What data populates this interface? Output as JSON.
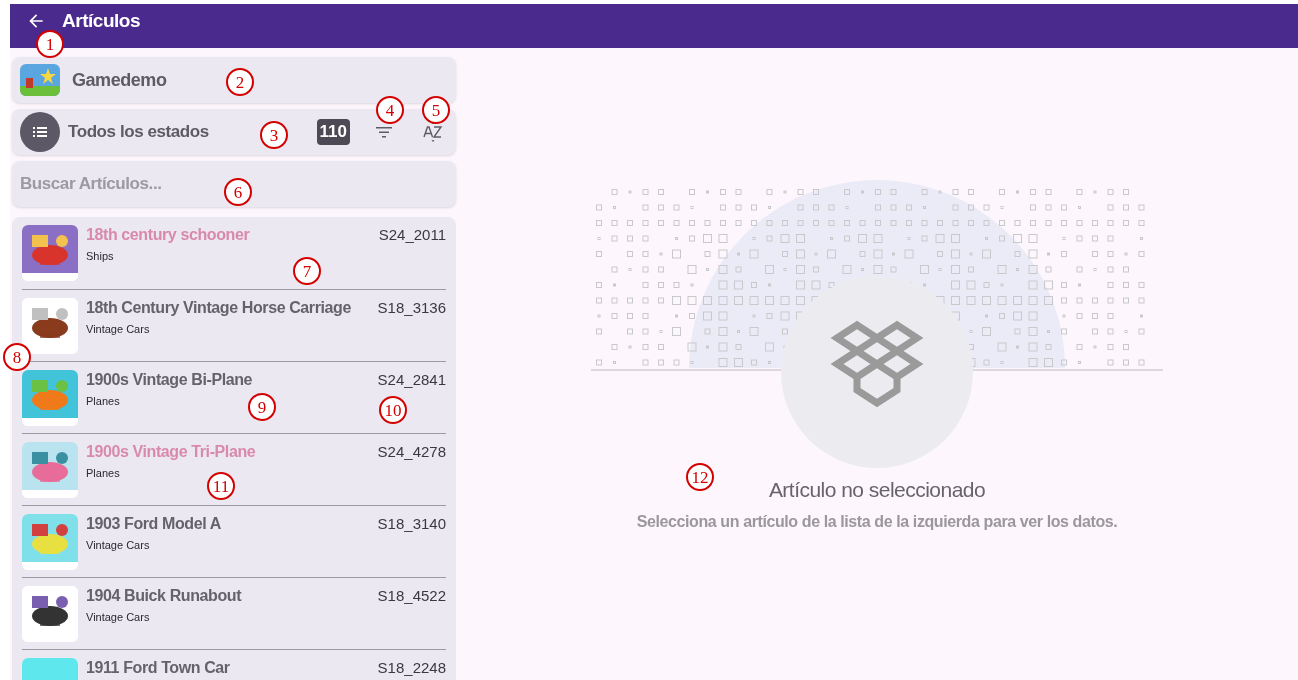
{
  "app_bar": {
    "title": "Artículos"
  },
  "company": {
    "name": "Gamedemo"
  },
  "status_filter": {
    "label": "Todos los estados",
    "count": "110"
  },
  "search": {
    "placeholder": "Buscar Artículos..."
  },
  "articles": [
    {
      "name": "18th century schooner",
      "category": "Ships",
      "code": "S24_2011",
      "inactive": true
    },
    {
      "name": "18th Century Vintage Horse Carriage",
      "category": "Vintage Cars",
      "code": "S18_3136",
      "inactive": false
    },
    {
      "name": "1900s Vintage Bi-Plane",
      "category": "Planes",
      "code": "S24_2841",
      "inactive": false
    },
    {
      "name": "1900s Vintage Tri-Plane",
      "category": "Planes",
      "code": "S24_4278",
      "inactive": true
    },
    {
      "name": "1903 Ford Model A",
      "category": "Vintage Cars",
      "code": "S18_3140",
      "inactive": false
    },
    {
      "name": "1904 Buick Runabout",
      "category": "Vintage Cars",
      "code": "S18_4522",
      "inactive": false
    },
    {
      "name": "1911 Ford Town Car",
      "code": "S18_2248",
      "inactive": false
    }
  ],
  "empty_state": {
    "title": "Artículo no seleccionado",
    "message": "Selecciona un artículo de la lista de la izquierda para ver los datos."
  },
  "callouts": [
    "1",
    "2",
    "3",
    "4",
    "5",
    "6",
    "7",
    "8",
    "9",
    "10",
    "11",
    "12"
  ]
}
